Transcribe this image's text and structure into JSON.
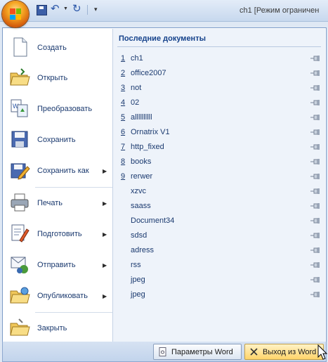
{
  "window": {
    "title": "ch1 [Режим ограничен"
  },
  "quick_access": {
    "save": "save-icon",
    "undo": "↶",
    "undo_dropdown": "▼",
    "redo": "↻",
    "customize": "▾"
  },
  "menu_commands": [
    {
      "label": "Создать",
      "icon": "new-document-icon",
      "submenu": false
    },
    {
      "label": "Открыть",
      "icon": "open-folder-icon",
      "submenu": false
    },
    {
      "label": "Преобразовать",
      "icon": "convert-icon",
      "submenu": false
    },
    {
      "label": "Сохранить",
      "icon": "save-disk-icon",
      "submenu": false
    },
    {
      "label": "Сохранить как",
      "icon": "save-as-icon",
      "submenu": true
    },
    {
      "label": "Печать",
      "icon": "printer-icon",
      "submenu": true
    },
    {
      "label": "Подготовить",
      "icon": "prepare-icon",
      "submenu": true
    },
    {
      "label": "Отправить",
      "icon": "send-icon",
      "submenu": true
    },
    {
      "label": "Опубликовать",
      "icon": "publish-icon",
      "submenu": true
    },
    {
      "label": "Закрыть",
      "icon": "close-folder-icon",
      "submenu": false
    }
  ],
  "arrow": "▶",
  "recent": {
    "title": "Последние документы",
    "documents": [
      {
        "num": "1",
        "name": "ch1"
      },
      {
        "num": "2",
        "name": "office2007"
      },
      {
        "num": "3",
        "name": "not"
      },
      {
        "num": "4",
        "name": "02"
      },
      {
        "num": "5",
        "name": "allllllllll"
      },
      {
        "num": "6",
        "name": "Ornatrix V1"
      },
      {
        "num": "7",
        "name": "http_fixed"
      },
      {
        "num": "8",
        "name": "books"
      },
      {
        "num": "9",
        "name": "rerwer"
      },
      {
        "num": "",
        "name": "xzvc"
      },
      {
        "num": "",
        "name": "saass"
      },
      {
        "num": "",
        "name": "Document34"
      },
      {
        "num": "",
        "name": "sdsd"
      },
      {
        "num": "",
        "name": "adress"
      },
      {
        "num": "",
        "name": "rss"
      },
      {
        "num": "",
        "name": "jpeg"
      },
      {
        "num": "",
        "name": "jpeg"
      }
    ]
  },
  "bottom": {
    "options_label": "Параметры Word",
    "exit_label": "Выход из Word"
  },
  "colors": {
    "accent": "#15428b",
    "exit_highlight": "#ffd46a",
    "office_orange": "#f5a623"
  }
}
